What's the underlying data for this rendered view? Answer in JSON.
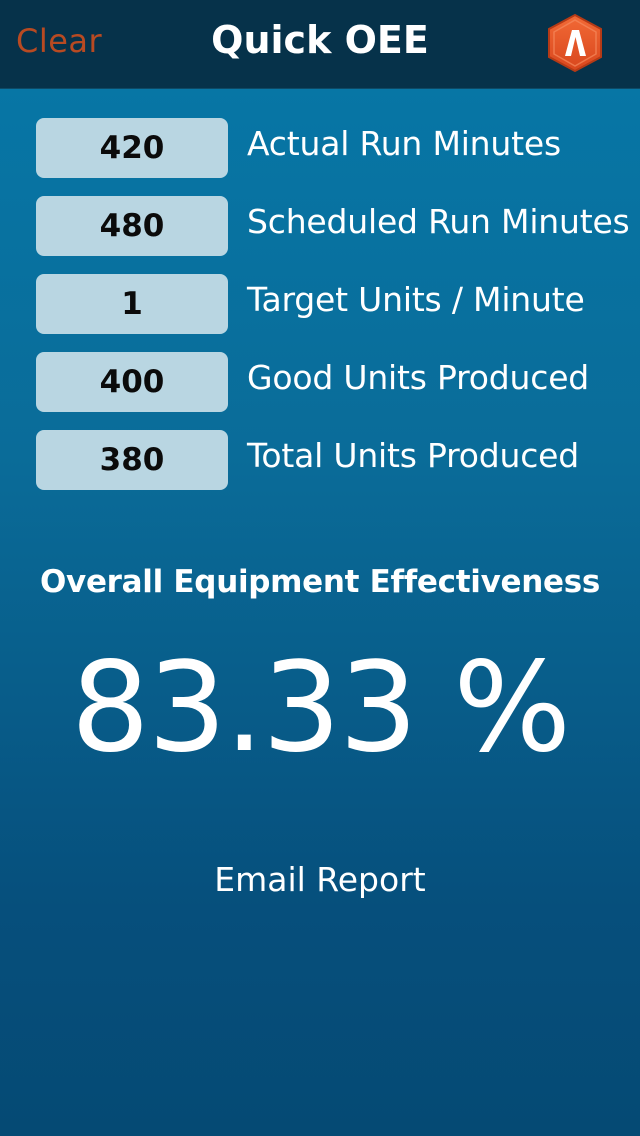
{
  "navbar": {
    "clear_label": "Clear",
    "title": "Quick OEE",
    "logo_icon": "hexagon-logo-icon",
    "logo_color": "#e8552a"
  },
  "inputs": [
    {
      "value": "420",
      "label": "Actual Run Minutes"
    },
    {
      "value": "480",
      "label": "Scheduled Run Minutes"
    },
    {
      "value": "1",
      "label": "Target Units / Minute"
    },
    {
      "value": "400",
      "label": "Good Units Produced"
    },
    {
      "value": "380",
      "label": "Total Units Produced"
    }
  ],
  "result": {
    "heading": "Overall Equipment Effectiveness",
    "value": "83.33 %"
  },
  "email_label": "Email Report",
  "colors": {
    "navbar_bg": "#06324a",
    "clear_text": "#b84a22",
    "field_bg": "#b9d6e2",
    "background_top": "#0678a8",
    "background_bottom": "#054a74"
  }
}
